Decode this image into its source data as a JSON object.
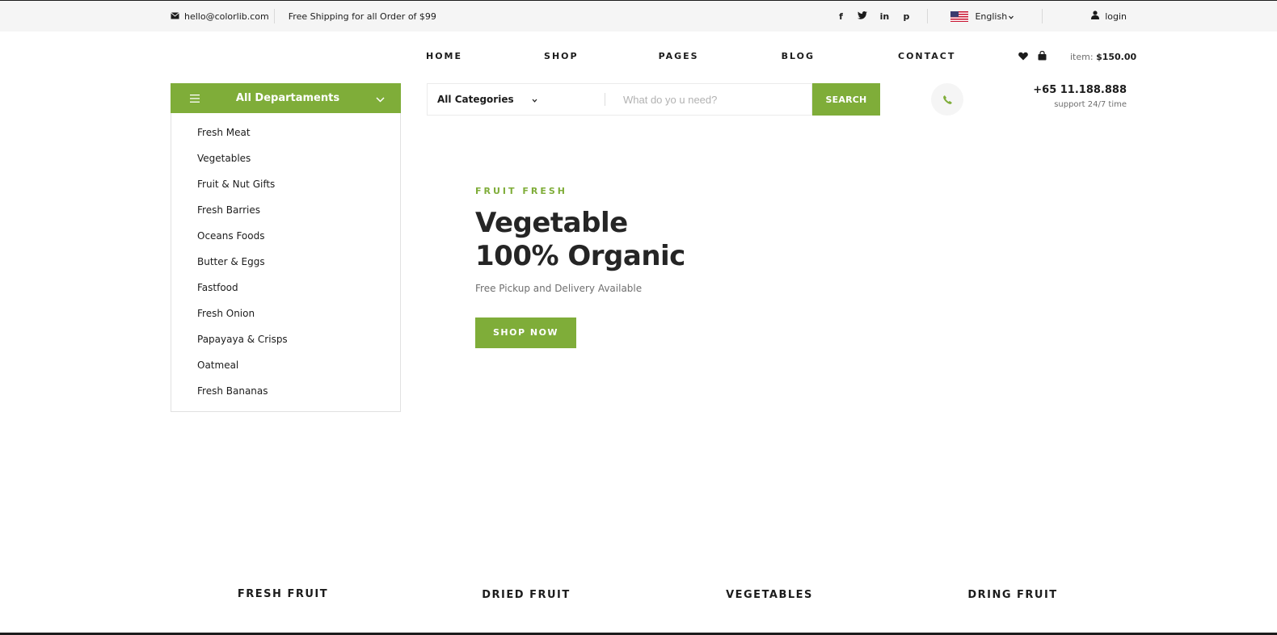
{
  "topbar": {
    "email": "hello@colorlib.com",
    "shipping": "Free Shipping for all Order of $99",
    "socials": {
      "facebook": "f",
      "twitter": "t",
      "linkedin": "in",
      "pinterest": "p"
    },
    "language": "English",
    "login": "login"
  },
  "nav": {
    "items": [
      "HOME",
      "SHOP",
      "PAGES",
      "BLOG",
      "CONTACT"
    ]
  },
  "cart": {
    "item_label": "item:",
    "total": "$150.00"
  },
  "departments": {
    "title": "All Departaments",
    "items": [
      "Fresh Meat",
      "Vegetables",
      "Fruit & Nut Gifts",
      "Fresh Barries",
      "Oceans Foods",
      "Butter & Eggs",
      "Fastfood",
      "Fresh Onion",
      "Papayaya & Crisps",
      "Oatmeal",
      "Fresh Bananas"
    ]
  },
  "search": {
    "category": "All Categories",
    "placeholder": "What do yo u need?",
    "button": "SEARCH"
  },
  "contact": {
    "phone": "+65 11.188.888",
    "support": "support 24/7 time"
  },
  "hero": {
    "tag": "FRUIT FRESH",
    "title_line1": "Vegetable",
    "title_line2": "100% Organic",
    "subtitle": "Free Pickup and Delivery Available",
    "button": "SHOP NOW"
  },
  "categories": [
    "FRESH FRUIT",
    "DRIED FRUIT",
    "VEGETABLES",
    "DRING FRUIT"
  ],
  "colors": {
    "accent": "#7fad39",
    "topbar_bg": "#f5f5f5",
    "text": "#1c1c1c",
    "muted": "#6f6f6f"
  }
}
